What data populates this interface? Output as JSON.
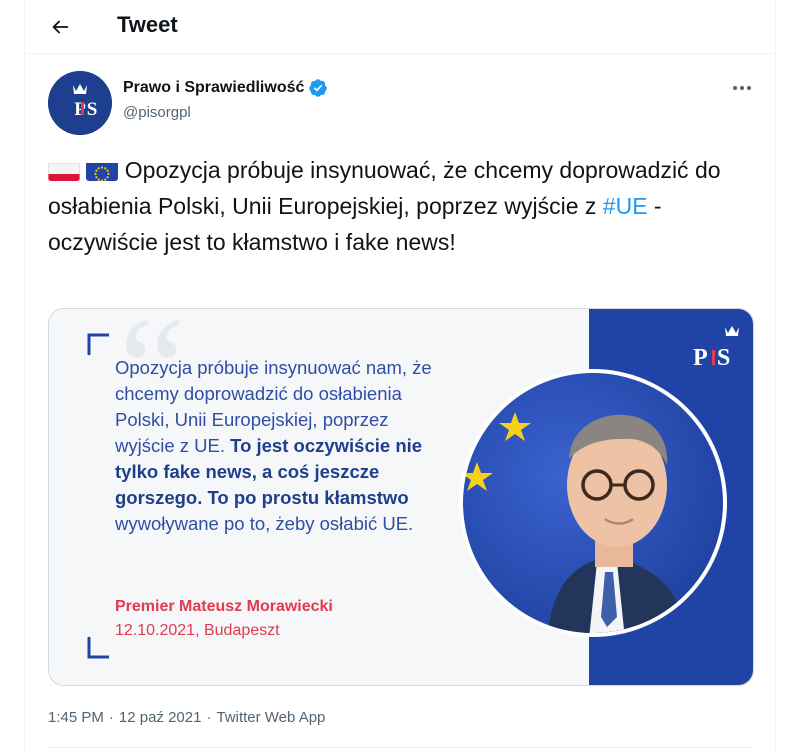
{
  "header": {
    "title": "Tweet"
  },
  "tweet": {
    "author": {
      "name": "Prawo i Sprawiedliwość",
      "handle": "@pisorgpl",
      "avatar_text": "PiS",
      "verified": true
    },
    "text_before": " Opozycja próbuje insynuować, że chcemy doprowadzić do osłabienia Polski, Unii Europejskiej, poprzez wyjście z ",
    "hashtag": "#UE",
    "text_after": " - oczywiście jest to kłamstwo i fake news!",
    "media": {
      "quote_part1": "Opozycja próbuje insynuować nam, że chcemy doprowadzić do osłabienia Polski, Unii Europejskiej, poprzez wyjście z UE. ",
      "quote_bold": "To jest oczywiście nie tylko fake news, a coś jeszcze gorszego. To po prostu kłamstwo",
      "quote_part2": " wywoływane po to, żeby osłabić UE.",
      "quote_author": "Premier Mateusz Morawiecki",
      "quote_date": "12.10.2021, Budapeszt",
      "logo_text": "PiS"
    },
    "meta": {
      "time": "1:45 PM",
      "separator": "·",
      "date": "12 paź 2021",
      "source": "Twitter Web App"
    }
  },
  "colors": {
    "accent": "#1d9bf0",
    "brand_blue": "#1f44a6",
    "quote_red": "#e23a4f"
  },
  "icons": {
    "back": "arrow-left-icon",
    "verified": "verified-badge-icon",
    "more": "more-horizontal-icon"
  }
}
